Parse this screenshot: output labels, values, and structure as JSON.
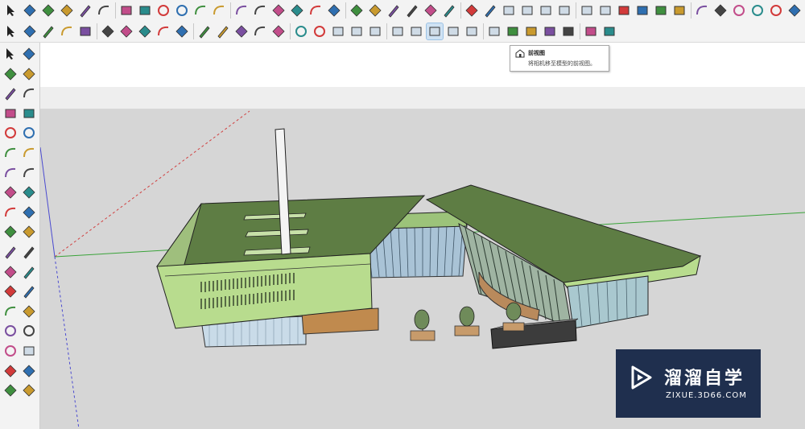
{
  "tooltip": {
    "title": "前视图",
    "description": "将相机移至模型的前视图。",
    "icon": "house-front-icon"
  },
  "watermark": {
    "brand": "溜溜自学",
    "url": "ZIXUE.3D66.COM",
    "icon": "play-triangle-icon"
  },
  "colors": {
    "roof_green": "#5e7d44",
    "wall_green": "#b8dc8e",
    "sky": "#ffffff",
    "ground": "#d6d6d6",
    "axis_red": "#d04040",
    "axis_green": "#3aa33a",
    "axis_blue": "#4a4ad0",
    "logo_bg": "#1f2f4e"
  },
  "toolbar_row1_icons": [
    "select-arrow-icon",
    "component-icon",
    "paint-bucket-icon",
    "eraser-icon",
    "pencil-line-icon",
    "freehand-icon",
    "rectangle-icon",
    "rotated-rectangle-icon",
    "circle-icon",
    "polygon-icon",
    "arc-icon",
    "two-point-arc-icon",
    "three-point-arc-icon",
    "pie-icon",
    "move-icon",
    "push-pull-icon",
    "rotate-icon",
    "follow-me-icon",
    "scale-icon",
    "offset-icon",
    "tape-measure-icon",
    "dimension-icon",
    "protractor-icon",
    "text-icon",
    "axes-icon",
    "3d-text-icon",
    "iso-view-icon",
    "top-view-icon",
    "front-view-icon",
    "right-view-icon",
    "back-view-icon",
    "left-view-icon",
    "xray-icon",
    "wireframe-icon",
    "hidden-line-icon",
    "shaded-icon",
    "orbit-icon",
    "pan-icon",
    "zoom-icon",
    "zoom-window-icon",
    "zoom-extents-icon",
    "walk-icon"
  ],
  "toolbar_row2_icons": [
    "select-arrow-icon",
    "eraser-icon",
    "pencil-line-icon",
    "arc-icon",
    "rectangle-icon",
    "push-pull-icon",
    "follow-me-icon",
    "move-icon",
    "rotate-icon",
    "scale-icon",
    "tape-measure-icon",
    "text-icon",
    "axes-icon",
    "orbit-icon",
    "pan-icon",
    "zoom-icon",
    "zoom-extents-icon",
    "previous-view-icon",
    "next-view-icon",
    "standard-views-icon",
    "iso-view-icon",
    "top-view-icon",
    "front-view-icon",
    "right-view-icon",
    "back-view-icon",
    "left-view-icon",
    "xray-icon",
    "wireframe-icon",
    "hidden-line-icon",
    "shaded-icon",
    "textured-icon",
    "monochrome-icon"
  ],
  "left_toolbar_icons": [
    "select-arrow-icon",
    "component-icon",
    "paint-bucket-icon",
    "eraser-icon",
    "pencil-line-icon",
    "freehand-icon",
    "rectangle-icon",
    "rotated-rectangle-icon",
    "circle-icon",
    "polygon-icon",
    "arc-icon",
    "two-point-arc-icon",
    "three-point-arc-icon",
    "pie-icon",
    "move-icon",
    "push-pull-icon",
    "rotate-icon",
    "follow-me-icon",
    "scale-icon",
    "offset-icon",
    "tape-measure-icon",
    "dimension-icon",
    "protractor-icon",
    "text-icon",
    "axes-icon",
    "3d-text-icon",
    "orbit-icon",
    "pan-icon",
    "zoom-icon",
    "zoom-window-icon",
    "zoom-extents-icon",
    "previous-view-icon",
    "position-camera-icon",
    "look-around-icon",
    "walk-icon",
    "section-plane-icon"
  ]
}
